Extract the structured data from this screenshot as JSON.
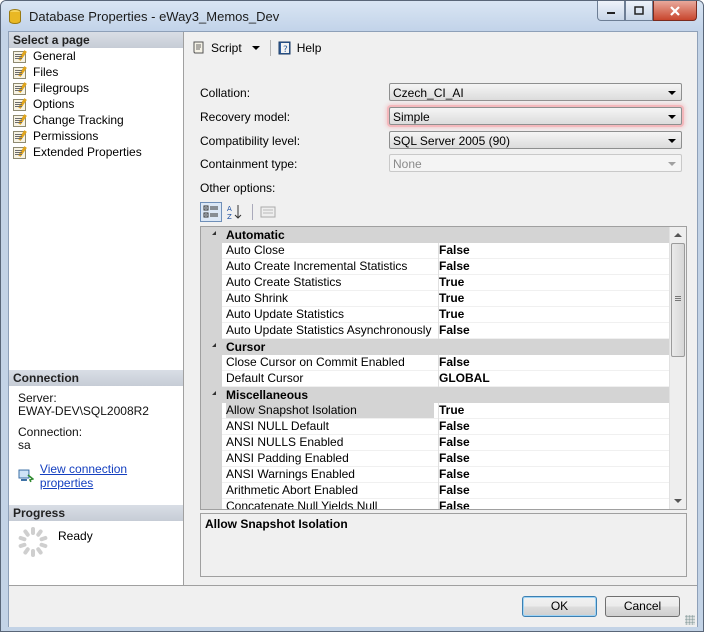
{
  "window": {
    "title": "Database Properties - eWay3_Memos_Dev"
  },
  "left_panel": {
    "select_header": "Select a page",
    "pages": [
      "General",
      "Files",
      "Filegroups",
      "Options",
      "Change Tracking",
      "Permissions",
      "Extended Properties"
    ],
    "connection_header": "Connection",
    "server_label": "Server:",
    "server_value": "EWAY-DEV\\SQL2008R2",
    "connection_label": "Connection:",
    "connection_value": "sa",
    "view_link": "View connection properties",
    "progress_header": "Progress",
    "progress_status": "Ready"
  },
  "toolbar": {
    "script_label": "Script",
    "help_label": "Help"
  },
  "options_form": {
    "collation_label": "Collation:",
    "collation_value": "Czech_CI_AI",
    "recovery_label": "Recovery model:",
    "recovery_value": "Simple",
    "compat_label": "Compatibility level:",
    "compat_value": "SQL Server 2005 (90)",
    "containment_label": "Containment type:",
    "containment_value": "None",
    "other_label": "Other options:"
  },
  "grid": {
    "categories": [
      {
        "name": "Automatic",
        "rows": [
          [
            "Auto Close",
            "False"
          ],
          [
            "Auto Create Incremental Statistics",
            "False"
          ],
          [
            "Auto Create Statistics",
            "True"
          ],
          [
            "Auto Shrink",
            "True"
          ],
          [
            "Auto Update Statistics",
            "True"
          ],
          [
            "Auto Update Statistics Asynchronously",
            "False"
          ]
        ]
      },
      {
        "name": "Cursor",
        "rows": [
          [
            "Close Cursor on Commit Enabled",
            "False"
          ],
          [
            "Default Cursor",
            "GLOBAL"
          ]
        ]
      },
      {
        "name": "Miscellaneous",
        "rows": [
          [
            "Allow Snapshot Isolation",
            "True"
          ],
          [
            "ANSI NULL Default",
            "False"
          ],
          [
            "ANSI NULLS Enabled",
            "False"
          ],
          [
            "ANSI Padding Enabled",
            "False"
          ],
          [
            "ANSI Warnings Enabled",
            "False"
          ],
          [
            "Arithmetic Abort Enabled",
            "False"
          ],
          [
            "Concatenate Null Yields Null",
            "False"
          ]
        ]
      }
    ],
    "selected_row": "Allow Snapshot Isolation"
  },
  "description": {
    "title": "Allow Snapshot Isolation"
  },
  "footer": {
    "ok_label": "OK",
    "cancel_label": "Cancel"
  }
}
